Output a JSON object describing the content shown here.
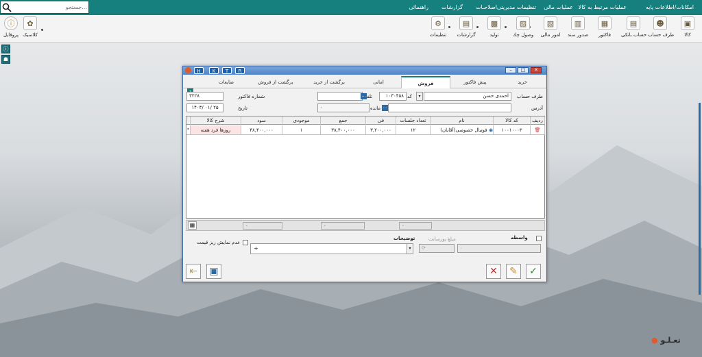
{
  "search": {
    "placeholder": "جستجو..."
  },
  "menu": [
    "امکانات/اطلاعات پایه",
    "عملیات مرتبط به کالا",
    "عملیات مالی",
    "تنظیمات مدیریتی",
    "اصلاحـات",
    "گزارشات",
    "راهنمائی"
  ],
  "toolbar": {
    "items": [
      "کالا",
      "طرف حساب",
      "حساب بانکی",
      "فاکتور",
      "صدور سند",
      "امور مالی",
      "وصول چك",
      "تولید",
      "گزارشات",
      "تنظیمات"
    ],
    "profile": "پروفایل",
    "classic": "کلاسیک"
  },
  "window": {
    "badges": [
      "H",
      "K",
      "T",
      "R"
    ],
    "tabs": [
      "خرید",
      "پیش فاکتور",
      "فروش",
      "امانی",
      "برگشت از خرید",
      "برگشت از فروش",
      "ضایعات"
    ],
    "active_tab": "فروش",
    "labels": {
      "account": "طرف حساب",
      "code": "کد",
      "phone": "تلفن",
      "address": "آدرس",
      "balance": "مانده",
      "invoice_no": "شماره فاکتور",
      "date": "تاریخ"
    },
    "values": {
      "account_name": "احمدی حسن",
      "code": "۱۰۳۰۴۵۸",
      "balance": "۰",
      "invoice_no": "۳۲۲۸",
      "date": "۱۴۰۳/ ۰۱/ ۲۵"
    },
    "columns": [
      "ردیف",
      "کد کالا",
      "نام",
      "تعداد جلسات",
      "فی",
      "جمع",
      "موجودی",
      "سود",
      "شرح کالا"
    ],
    "rows": [
      {
        "code": "۱۰۰۱۰۰۰۳",
        "name": "فوتبال خصوصی(آقایان)",
        "qty": "۱۲",
        "price": "۳,۲۰۰,۰۰۰",
        "total": "۳۸,۴۰۰,۰۰۰",
        "stock": "۱",
        "profit": "۳۸,۴۰۰,۰۰۰",
        "desc": "روزها فرد هفته"
      }
    ],
    "totals": [
      "۰",
      "۰",
      "۰"
    ],
    "intermediary": "واسطه",
    "commission": "مبلغ پورسانت",
    "commission_value": "۰",
    "descriptions_label": "توضیحات",
    "descriptions_value": "+",
    "hide_price": "عدم نمایش ریز قیمت",
    "row_marker": "*"
  },
  "brand": "تعـلـو",
  "colors": {
    "menubar": "#16807f",
    "accent": "#2a6aa8",
    "cancel": "#c9302c",
    "confirm": "#2e8b2e"
  }
}
